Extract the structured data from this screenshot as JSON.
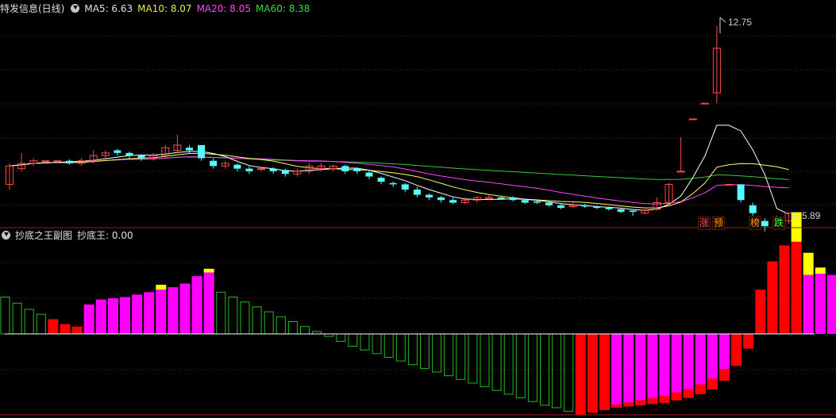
{
  "main_header": {
    "title": "特发信息(日线)",
    "ma5": "MA5: 6.63",
    "ma10": "MA10: 8.07",
    "ma20": "MA20: 8.05",
    "ma60": "MA60: 8.38"
  },
  "sub_header": {
    "title": "抄底之王副图",
    "value": "抄底王: 0.00"
  },
  "annotations": {
    "high": "12.75",
    "low": "5.89",
    "tag_zhang": "涨",
    "tag_yu": "预",
    "tag_bang": "榜",
    "tag_die": "跌"
  },
  "colors": {
    "up": "#ff4a4a",
    "down": "#54ffff",
    "ma5": "#ffffff",
    "ma10": "#ffff66",
    "ma20": "#ff44ff",
    "ma60": "#33cc33",
    "grid": "#7a1a1a",
    "magenta": "#ff00ff",
    "red": "#ff0000",
    "yellow": "#ffff00",
    "green_outline": "#22bb22"
  },
  "chart_data": [
    {
      "type": "candlestick",
      "title": "特发信息(日线)",
      "ylim": [
        5.5,
        13.2
      ],
      "candles": [
        [
          6.7,
          7.4,
          6.5,
          7.5
        ],
        [
          7.3,
          7.5,
          7.2,
          7.9
        ],
        [
          7.5,
          7.6,
          7.4,
          7.7
        ],
        [
          7.6,
          7.6,
          7.5,
          7.6
        ],
        [
          7.6,
          7.6,
          7.5,
          7.6
        ],
        [
          7.6,
          7.5,
          7.45,
          7.65
        ],
        [
          7.5,
          7.6,
          7.4,
          7.7
        ],
        [
          7.6,
          7.8,
          7.5,
          8.0
        ],
        [
          7.8,
          7.9,
          7.7,
          8.0
        ],
        [
          8.0,
          7.9,
          7.8,
          8.05
        ],
        [
          7.9,
          7.8,
          7.7,
          7.95
        ],
        [
          7.8,
          7.7,
          7.6,
          7.85
        ],
        [
          7.7,
          7.8,
          7.6,
          7.9
        ],
        [
          7.8,
          8.1,
          7.7,
          8.2
        ],
        [
          8.0,
          8.2,
          7.9,
          8.6
        ],
        [
          8.1,
          8.0,
          7.9,
          8.2
        ],
        [
          8.2,
          7.7,
          7.6,
          8.2
        ],
        [
          7.6,
          7.4,
          7.3,
          7.7
        ],
        [
          7.4,
          7.5,
          7.3,
          7.6
        ],
        [
          7.45,
          7.3,
          7.2,
          7.5
        ],
        [
          7.3,
          7.2,
          7.1,
          7.4
        ],
        [
          7.3,
          7.3,
          7.2,
          7.4
        ],
        [
          7.3,
          7.2,
          7.1,
          7.35
        ],
        [
          7.25,
          7.1,
          7.0,
          7.3
        ],
        [
          7.1,
          7.2,
          7.0,
          7.3
        ],
        [
          7.2,
          7.4,
          7.1,
          7.5
        ],
        [
          7.3,
          7.4,
          7.2,
          7.5
        ],
        [
          7.3,
          7.4,
          7.2,
          7.45
        ],
        [
          7.4,
          7.2,
          7.1,
          7.45
        ],
        [
          7.3,
          7.2,
          7.1,
          7.35
        ],
        [
          7.15,
          7.0,
          6.9,
          7.2
        ],
        [
          6.95,
          6.8,
          6.7,
          7.0
        ],
        [
          6.75,
          6.7,
          6.6,
          6.8
        ],
        [
          6.7,
          6.5,
          6.4,
          6.75
        ],
        [
          6.5,
          6.3,
          6.2,
          6.6
        ],
        [
          6.3,
          6.2,
          6.1,
          6.35
        ],
        [
          6.2,
          6.1,
          6.0,
          6.25
        ],
        [
          6.1,
          6.0,
          5.95,
          6.2
        ],
        [
          6.0,
          6.1,
          5.95,
          6.2
        ],
        [
          6.1,
          6.2,
          6.0,
          6.25
        ],
        [
          6.15,
          6.2,
          6.1,
          6.3
        ],
        [
          6.2,
          6.15,
          6.1,
          6.25
        ],
        [
          6.2,
          6.1,
          6.05,
          6.25
        ],
        [
          6.1,
          6.0,
          5.95,
          6.15
        ],
        [
          6.05,
          6.0,
          5.95,
          6.1
        ],
        [
          6.0,
          5.9,
          5.85,
          6.05
        ],
        [
          5.9,
          5.8,
          5.75,
          5.95
        ],
        [
          5.85,
          5.9,
          5.8,
          6.0
        ],
        [
          5.9,
          5.85,
          5.8,
          5.95
        ],
        [
          5.85,
          5.8,
          5.75,
          5.9
        ],
        [
          5.8,
          5.75,
          5.7,
          5.85
        ],
        [
          5.75,
          5.65,
          5.6,
          5.8
        ],
        [
          5.7,
          5.65,
          5.5,
          5.7
        ],
        [
          5.6,
          5.7,
          5.55,
          5.75
        ],
        [
          5.75,
          6.0,
          5.7,
          6.2
        ],
        [
          6.0,
          6.7,
          5.95,
          6.75
        ],
        [
          7.2,
          7.2,
          7.2,
          8.5
        ],
        [
          9.2,
          9.2,
          9.2,
          9.2
        ],
        [
          9.8,
          9.8,
          9.8,
          9.8
        ],
        [
          10.2,
          11.9,
          9.8,
          12.75
        ],
        [
          6.7,
          6.7,
          6.7,
          6.7
        ],
        [
          6.7,
          6.1,
          6.0,
          6.7
        ],
        [
          5.9,
          5.6,
          5.5,
          6.0
        ],
        [
          5.3,
          5.1,
          4.9,
          5.4
        ],
        [
          5.4,
          5.4,
          5.3,
          5.5
        ],
        [
          5.3,
          5.6,
          5.2,
          5.6
        ]
      ]
    },
    {
      "type": "bar",
      "title": "抄底之王副图",
      "baseline": 0,
      "bars": [
        [
          "h",
          3
        ],
        [
          "h",
          2.5
        ],
        [
          "h",
          2
        ],
        [
          "h",
          1.6
        ],
        [
          "r",
          1.2
        ],
        [
          "r",
          0.8
        ],
        [
          "r",
          0.6
        ],
        [
          "m",
          2.4
        ],
        [
          "m",
          2.8
        ],
        [
          "m",
          2.9
        ],
        [
          "m",
          3.0
        ],
        [
          "m",
          3.2
        ],
        [
          "m",
          3.4
        ],
        [
          "m",
          3.6
        ],
        [
          "m",
          3.8
        ],
        [
          "m",
          4.1
        ],
        [
          "m",
          4.7
        ],
        [
          "m",
          5.0
        ],
        [
          "h",
          3.4
        ],
        [
          "h",
          3.0
        ],
        [
          "h",
          2.6
        ],
        [
          "h",
          2.2
        ],
        [
          "h",
          1.8
        ],
        [
          "h",
          1.4
        ],
        [
          "h",
          1.0
        ],
        [
          "h",
          0.6
        ],
        [
          "h",
          0.2
        ],
        [
          "h",
          -0.2
        ],
        [
          "h",
          -0.6
        ],
        [
          "h",
          -1.0
        ],
        [
          "h",
          -1.3
        ],
        [
          "h",
          -1.6
        ],
        [
          "h",
          -1.9
        ],
        [
          "h",
          -2.2
        ],
        [
          "h",
          -2.5
        ],
        [
          "h",
          -2.8
        ],
        [
          "h",
          -3.1
        ],
        [
          "h",
          -3.4
        ],
        [
          "h",
          -3.7
        ],
        [
          "h",
          -4.0
        ],
        [
          "h",
          -4.3
        ],
        [
          "h",
          -4.6
        ],
        [
          "h",
          -4.9
        ],
        [
          "h",
          -5.2
        ],
        [
          "h",
          -5.5
        ],
        [
          "h",
          -5.8
        ],
        [
          "h",
          -6.0
        ],
        [
          "h",
          -6.3
        ],
        [
          "r",
          -6.6
        ],
        [
          "r",
          -6.4
        ],
        [
          "r",
          -6.2
        ],
        [
          "m",
          -6.0
        ],
        [
          "m",
          -5.9
        ],
        [
          "m",
          -5.8
        ],
        [
          "m",
          -5.7
        ],
        [
          "m",
          -5.6
        ],
        [
          "m",
          -5.4
        ],
        [
          "m",
          -5.2
        ],
        [
          "m",
          -4.9
        ],
        [
          "m",
          -4.5
        ],
        [
          "m",
          -3.8
        ],
        [
          "r",
          -2.6
        ],
        [
          "r",
          -1.2
        ],
        [
          "r",
          3.6
        ],
        [
          "r",
          5.9
        ],
        [
          "r",
          7.2
        ],
        [
          "r",
          7.5
        ],
        [
          "m",
          4.8
        ],
        [
          "m",
          4.9
        ],
        [
          "m",
          4.8
        ],
        [
          "m",
          4.6
        ],
        [
          "h",
          3.0
        ],
        [
          "h",
          2.5
        ],
        [
          "h",
          1.0
        ]
      ],
      "yellow_caps": {
        "13": 0.4,
        "17": 0.3,
        "66": 2.4,
        "67": 1.8,
        "68": 0.5
      }
    }
  ]
}
